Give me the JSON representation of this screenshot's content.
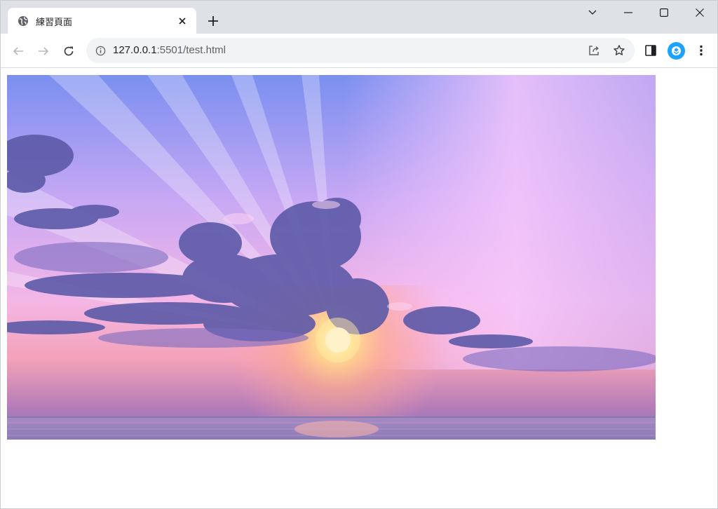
{
  "tab": {
    "title": "練習頁面",
    "favicon": "globe-icon",
    "close": "close-icon"
  },
  "toolbar": {
    "url_host": "127.0.0.1",
    "url_rest": ":5501/test.html"
  },
  "icons": {
    "new_tab": "plus-icon",
    "tab_search": "chevron-down-icon",
    "minimize": "minimize-icon",
    "maximize": "maximize-icon",
    "close_window": "close-icon",
    "back": "arrow-left-icon",
    "forward": "arrow-right-icon",
    "reload": "reload-icon",
    "site_info": "info-icon",
    "share": "share-icon",
    "bookmark": "star-icon",
    "side_panel": "side-panel-icon",
    "extension": "extension-icon",
    "menu": "kebab-menu-icon"
  },
  "content": {
    "image": "sunset-sky-photo"
  },
  "colors": {
    "tabstrip_bg": "#dee1e6",
    "omnibox_bg": "#f1f3f4",
    "extension_accent": "#1aa3ff"
  }
}
